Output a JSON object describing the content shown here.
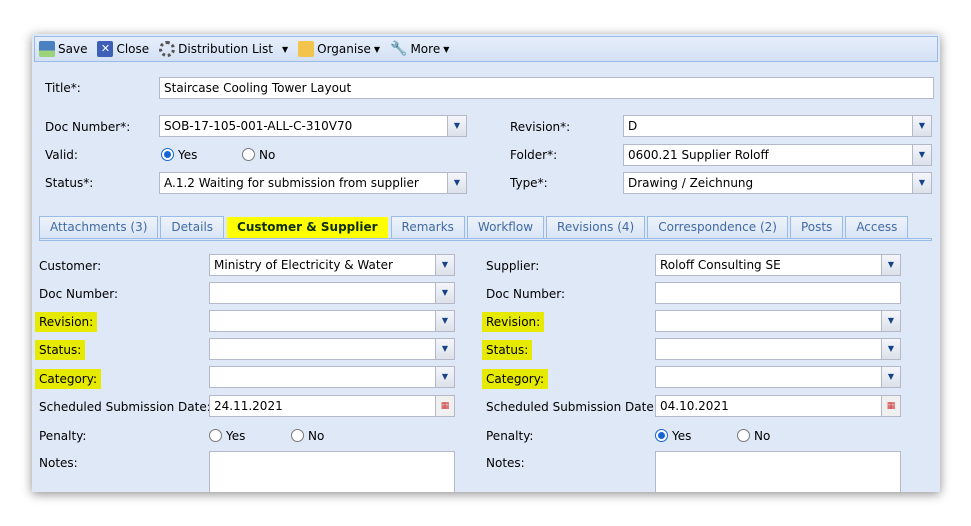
{
  "toolbar": {
    "save": "Save",
    "close": "Close",
    "distribution": "Distribution List",
    "organise": "Organise",
    "more": "More"
  },
  "header": {
    "title_label": "Title*:",
    "title_value": "Staircase Cooling Tower Layout",
    "docnum_label": "Doc Number*:",
    "docnum_value": "SOB-17-105-001-ALL-C-310V70",
    "valid_label": "Valid:",
    "valid_yes": "Yes",
    "valid_no": "No",
    "valid_selected": "Yes",
    "status_label": "Status*:",
    "status_value": "A.1.2 Waiting for submission from supplier",
    "revision_label": "Revision*:",
    "revision_value": "D",
    "folder_label": "Folder*:",
    "folder_value": "0600.21 Supplier Roloff",
    "type_label": "Type*:",
    "type_value": "Drawing / Zeichnung"
  },
  "tabs": [
    {
      "label": "Attachments (3)"
    },
    {
      "label": "Details"
    },
    {
      "label": "Customer & Supplier",
      "active": true
    },
    {
      "label": "Remarks"
    },
    {
      "label": "Workflow"
    },
    {
      "label": "Revisions (4)"
    },
    {
      "label": "Correspondence (2)"
    },
    {
      "label": "Posts"
    },
    {
      "label": "Access"
    }
  ],
  "customer": {
    "customer_label": "Customer:",
    "customer_value": "Ministry of Electricity & Water",
    "docnum_label": "Doc Number:",
    "revision_label": "Revision:",
    "status_label": "Status:",
    "category_label": "Category:",
    "date_label": "Scheduled Submission Date:",
    "date_value": "24.11.2021",
    "penalty_label": "Penalty:",
    "yes": "Yes",
    "no": "No",
    "penalty_selected": "none",
    "notes_label": "Notes:"
  },
  "supplier": {
    "supplier_label": "Supplier:",
    "supplier_value": "Roloff Consulting SE",
    "docnum_label": "Doc Number:",
    "revision_label": "Revision:",
    "status_label": "Status:",
    "category_label": "Category:",
    "date_label": "Scheduled Submission Date:",
    "date_value": "04.10.2021",
    "penalty_label": "Penalty:",
    "yes": "Yes",
    "no": "No",
    "penalty_selected": "Yes",
    "notes_label": "Notes:"
  },
  "colors": {
    "highlight": "#e6ea00",
    "panel": "#dfe8f6",
    "tab_border": "#99bbe8"
  }
}
